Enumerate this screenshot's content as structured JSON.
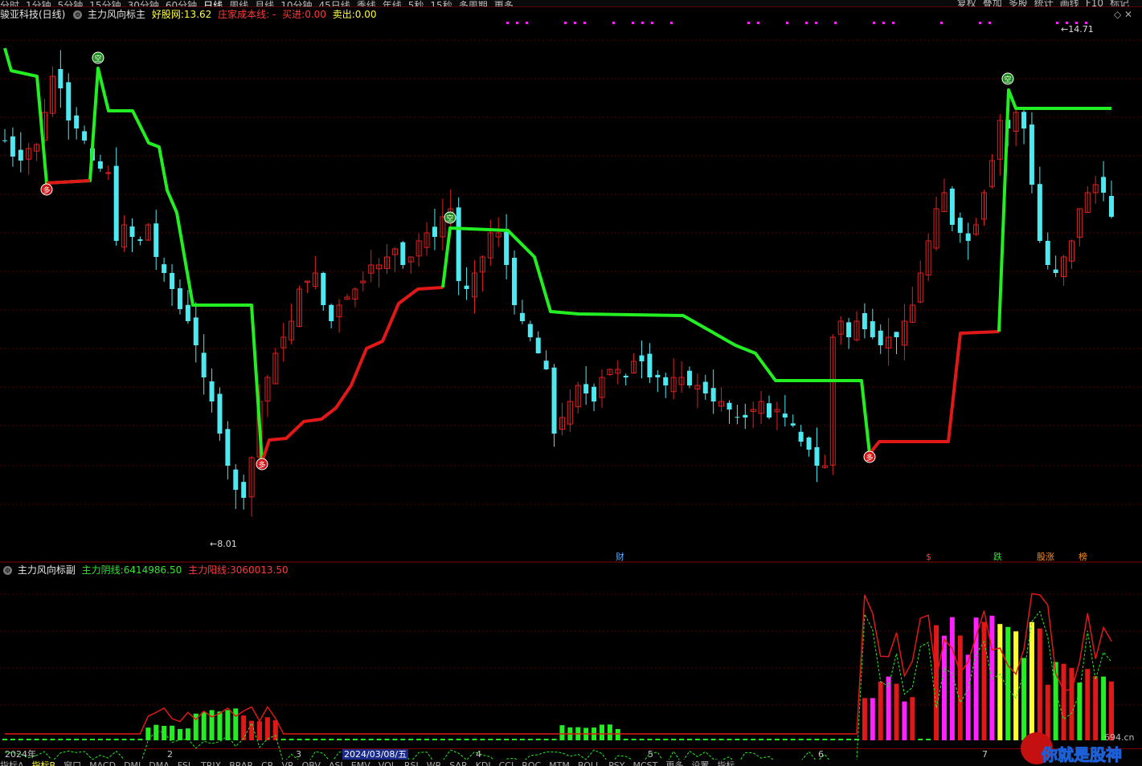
{
  "toolbar": {
    "periods": [
      "分时",
      "1分钟",
      "5分钟",
      "15分钟",
      "30分钟",
      "60分钟",
      "日线",
      "周线",
      "月线",
      "10分钟",
      "45日线",
      "季线",
      "年线",
      "5秒",
      "15秒",
      "多周期",
      "更多"
    ],
    "right_items": [
      "复权",
      "叠加",
      "多股",
      "统计",
      "画线",
      "F10",
      "标记"
    ],
    "active_period": "日线"
  },
  "main": {
    "stock_title": "骏亚科技(日线)",
    "indicator_name": "主力风向标主",
    "labels": {
      "a": "好股网:",
      "b": "庄家成本线: -",
      "c": "买进:",
      "d": "卖出:"
    },
    "values": {
      "a": "13.62",
      "c": "0.00",
      "d": "0.00"
    },
    "high_label": "14.71",
    "low_label": "8.01",
    "markers": {
      "sell": "空",
      "buy": "多"
    },
    "events": [
      {
        "label": "财",
        "color": "#5aaaff"
      },
      {
        "label": "$",
        "color": "#ff3b3b"
      },
      {
        "label": "跌",
        "color": "#31e431"
      },
      {
        "label": "股涨",
        "color": "#ff8c1a"
      },
      {
        "label": "榜",
        "color": "#ff8c1a"
      }
    ]
  },
  "sub": {
    "indicator_name": "主力风向标副",
    "labels": {
      "yin": "主力阴线:",
      "yang": "主力阳线:"
    },
    "values": {
      "yin": "6414986.50",
      "yang": "3060013.50"
    }
  },
  "date_axis": [
    "2024年",
    "2",
    "3",
    "2024/03/08/五",
    "4",
    "5",
    "6",
    "7"
  ],
  "bottom_tabs": [
    "指标A",
    "指标B",
    "窗口",
    "MACD",
    "DMI",
    "DMA",
    "FSL",
    "TRIX",
    "BRAR",
    "CR",
    "VR",
    "OBV",
    "ASI",
    "EMV",
    "VOL",
    "RSI",
    "WR",
    "SAR",
    "KDJ",
    "CCI",
    "ROC",
    "MTM",
    "BOLL",
    "PSY",
    "MCST",
    "更多",
    "设置",
    "指标"
  ],
  "watermark": {
    "text": "你就是股神",
    "url": "694.cn"
  },
  "colors": {
    "bull": "#e02020",
    "bear": "#4ee8f0",
    "up_line": "#e01818",
    "down_line": "#22ee22",
    "magenta": "#ff22ff",
    "yellow": "#ffff30"
  },
  "chart_data": {
    "type": "candlestick",
    "x": [
      0,
      1,
      2,
      3,
      4,
      5,
      6,
      7,
      8,
      9,
      10,
      11,
      12,
      13,
      14,
      15,
      16,
      17,
      18,
      19,
      20,
      21,
      22,
      23,
      24,
      25,
      26,
      27,
      28,
      29,
      30,
      31,
      32,
      33,
      34,
      35,
      36,
      37,
      38,
      39,
      40,
      41,
      42,
      43,
      44,
      45,
      46,
      47,
      48,
      49,
      50,
      51,
      52,
      53,
      54,
      55,
      56,
      57,
      58,
      59,
      60,
      61,
      62,
      63,
      64,
      65,
      66,
      67,
      68,
      69,
      70,
      71,
      72,
      73,
      74,
      75,
      76,
      77,
      78,
      79,
      80,
      81,
      82,
      83,
      84,
      85,
      86,
      87,
      88,
      89,
      90,
      91,
      92,
      93,
      94,
      95,
      96,
      97,
      98,
      99,
      100,
      101,
      102,
      103,
      104,
      105,
      106,
      107,
      108,
      109,
      110,
      111,
      112,
      113,
      114,
      115,
      116,
      117,
      118,
      119,
      120,
      121,
      122,
      123,
      124,
      125,
      126,
      127,
      128,
      129,
      130,
      131,
      132,
      133,
      134,
      135,
      136,
      137,
      138,
      139,
      140,
      141,
      142,
      143,
      144,
      145,
      146,
      147,
      148,
      149,
      150,
      151,
      152,
      153,
      154,
      155,
      156,
      157,
      158,
      159,
      160,
      161,
      162,
      163,
      164,
      165,
      166,
      167,
      168,
      169,
      170,
      171,
      172,
      173,
      174,
      175,
      176,
      177,
      178,
      179,
      180,
      181,
      182,
      183,
      184,
      185,
      186,
      187,
      188,
      189,
      190,
      191,
      192,
      193,
      194,
      195,
      196,
      197,
      198,
      199,
      200,
      201,
      202,
      203,
      204,
      205,
      206,
      207,
      208,
      209,
      210,
      211,
      212,
      213,
      214,
      215,
      216,
      217,
      218,
      219,
      220,
      221,
      222,
      223,
      224,
      225,
      226,
      227,
      228,
      229,
      230,
      231,
      232,
      233,
      234,
      235,
      236,
      237,
      238,
      239,
      240,
      241,
      242,
      243,
      244,
      245,
      246,
      247,
      248,
      249,
      250,
      251,
      252,
      253,
      254,
      255,
      256,
      257,
      258,
      259,
      260,
      261,
      262,
      263,
      264,
      265,
      266,
      267,
      268,
      269,
      270,
      271,
      272,
      273,
      274,
      275,
      276,
      277,
      278,
      279,
      280,
      281,
      282,
      283,
      284,
      285,
      286,
      287,
      288,
      289,
      290,
      291,
      292,
      293,
      294,
      295,
      296,
      297,
      298,
      299,
      300,
      301,
      302,
      303,
      304,
      305,
      306,
      307,
      308,
      309,
      310,
      311,
      312,
      313,
      314,
      315,
      316,
      317,
      318,
      319,
      320,
      321,
      322,
      323,
      324,
      325,
      326,
      327,
      328,
      329,
      330,
      331,
      332,
      333,
      334,
      335,
      336,
      337,
      338,
      339,
      340,
      341,
      342,
      343,
      344,
      345,
      346,
      347,
      348,
      349,
      350,
      351,
      352,
      353,
      354,
      355,
      356,
      357,
      358,
      359,
      360,
      361,
      362,
      363,
      364,
      365,
      366,
      367,
      368,
      369,
      370,
      371,
      372,
      373,
      374,
      375,
      376,
      377,
      378,
      379,
      380,
      381,
      382,
      383,
      384,
      385,
      386,
      387,
      388,
      389,
      390,
      391,
      392,
      393,
      394,
      395,
      396,
      397,
      398,
      399,
      400,
      401,
      402,
      403,
      404,
      405,
      406,
      407,
      408,
      409,
      410,
      411,
      412,
      413,
      414,
      415,
      416,
      417,
      418,
      419,
      420,
      421,
      422,
      423,
      424,
      425,
      426,
      427,
      428,
      429,
      430,
      431,
      432,
      433,
      434,
      435,
      436,
      437,
      438,
      439,
      440,
      441,
      442,
      443,
      444,
      445,
      446,
      447,
      448,
      449,
      450,
      451,
      452,
      453,
      454,
      455,
      456,
      457,
      458,
      459,
      460,
      461,
      462,
      463,
      464,
      465,
      466,
      467,
      468,
      469,
      470,
      471,
      472,
      473,
      474,
      475,
      476,
      477,
      478,
      479,
      480,
      481,
      482,
      483,
      484,
      485,
      486,
      487,
      488,
      489,
      490,
      491,
      492,
      493,
      494,
      495,
      496,
      497,
      498,
      499,
      500,
      501,
      502,
      503,
      504,
      505,
      506,
      507,
      508,
      509,
      510,
      511,
      512,
      513,
      514,
      515,
      516,
      517,
      518,
      519,
      520,
      521,
      522,
      523,
      524,
      525,
      526,
      527,
      528,
      529,
      530,
      531,
      532,
      533,
      534,
      535,
      536,
      537,
      538,
      539,
      540,
      541,
      542,
      543,
      544,
      545,
      546,
      547,
      548,
      549,
      550,
      551,
      552,
      553,
      554,
      555,
      556,
      557,
      558,
      559,
      560,
      561,
      562,
      563,
      564,
      565,
      566,
      567,
      568,
      569,
      570,
      571,
      572,
      573,
      574,
      575,
      576,
      577,
      578,
      579,
      580,
      581,
      582,
      583,
      584,
      585,
      586,
      587,
      588,
      589,
      590,
      591,
      592,
      593,
      594,
      595,
      596,
      597,
      598,
      599,
      600,
      601,
      602,
      603,
      604,
      605,
      606,
      607,
      608,
      609,
      610,
      611,
      612,
      613,
      614,
      615,
      616,
      617,
      618,
      619,
      620,
      621,
      622,
      623,
      624,
      625,
      626,
      627,
      628,
      629,
      630,
      631,
      632,
      633,
      634,
      635,
      636,
      637,
      638,
      639,
      640,
      641,
      642,
      643,
      644,
      645,
      646,
      647,
      648,
      649,
      650,
      651,
      652,
      653,
      654,
      655,
      656,
      657,
      658,
      659,
      660,
      661,
      662,
      663,
      664,
      665,
      666,
      667,
      668,
      669,
      670,
      671,
      672,
      673,
      674,
      675,
      676,
      677,
      678,
      679,
      680,
      681,
      682,
      683,
      684,
      685,
      686,
      687,
      688,
      689,
      690,
      691,
      692,
      693,
      694,
      695,
      696,
      697,
      698,
      699,
      700,
      701,
      702,
      703,
      704,
      705,
      706,
      707,
      708,
      709,
      710,
      711,
      712,
      713,
      714,
      715,
      716,
      717,
      718,
      719,
      720,
      721,
      722,
      723,
      724,
      725,
      726,
      727,
      728,
      729,
      730,
      731,
      732,
      733,
      734,
      735,
      736,
      737,
      738,
      739,
      740,
      741,
      742,
      743,
      744,
      745,
      746,
      747,
      748,
      749,
      750,
      751,
      752,
      753,
      754,
      755,
      756,
      757,
      758,
      759,
      760,
      761,
      762,
      763,
      764,
      765,
      766,
      767,
      768,
      769,
      770,
      771,
      772,
      773,
      774,
      775,
      776,
      777,
      778,
      779,
      780,
      781,
      782,
      783,
      784,
      785,
      786,
      787,
      788,
      789,
      790,
      791,
      792,
      793,
      794,
      795,
      796,
      797,
      798,
      799,
      800,
      801,
      802,
      803,
      804,
      805,
      806,
      807,
      808,
      809,
      810,
      811,
      812,
      813,
      814,
      815,
      816,
      817,
      818,
      819,
      820,
      821,
      822,
      823,
      824,
      825,
      826,
      827,
      828,
      829,
      830,
      831,
      832,
      833,
      834,
      835,
      836,
      837,
      838,
      839,
      840,
      841,
      842,
      843,
      844,
      845,
      846,
      847,
      848,
      849,
      850,
      851,
      852,
      853,
      854,
      855,
      856,
      857,
      858,
      859,
      860,
      861,
      862,
      863,
      864,
      865,
      866,
      867,
      868,
      869,
      870,
      871,
      872,
      873,
      874,
      875,
      876,
      877,
      878,
      879,
      880,
      881,
      882,
      883,
      884,
      885,
      886,
      887,
      888,
      889,
      890,
      891,
      892,
      893,
      894,
      895,
      896,
      897,
      898,
      899,
      900,
      901,
      902,
      903,
      904,
      905,
      906,
      907,
      908,
      909,
      910,
      911,
      912,
      913,
      914,
      915,
      916,
      917,
      918,
      919,
      920,
      921,
      922,
      923,
      924,
      925,
      926,
      927,
      928,
      929,
      930,
      931,
      932,
      933,
      934,
      935,
      936,
      937,
      938,
      939,
      940,
      941,
      942,
      943,
      944,
      945,
      946,
      947,
      948,
      949,
      950,
      951,
      952,
      953,
      954,
      955,
      956,
      957,
      958,
      959,
      960,
      961,
      962,
      963,
      964,
      965,
      966,
      967,
      968,
      969,
      970,
      971,
      972,
      973,
      974,
      975,
      976,
      977,
      978,
      979,
      980,
      981,
      982,
      983,
      984,
      985,
      986,
      987,
      988,
      989,
      990,
      991,
      992,
      993,
      994,
      995,
      996,
      997,
      998,
      999,
      1000,
      1001,
      1002,
      1003,
      1004,
      1005,
      1006,
      1007,
      1008,
      1009,
      1010,
      1011,
      1012,
      1013,
      1014,
      1015,
      1016,
      1017,
      1018,
      1019,
      1020,
      1021,
      1022,
      1023,
      1024,
      1025,
      1026,
      1027,
      1028,
      1029,
      1030,
      1031,
      1032,
      1033,
      1034,
      1035,
      1036,
      1037,
      1038,
      1039,
      1040,
      1041,
      1042,
      1043,
      1044,
      1045,
      1046,
      1047,
      1048,
      1049,
      1050,
      1051,
      1052,
      1053,
      1054,
      1055,
      1056,
      1057,
      1058,
      1059,
      1060,
      1061,
      1062,
      1063,
      1064,
      1065,
      1066,
      1067,
      1068,
      1069,
      1070,
      1071,
      1072,
      1073,
      1074,
      1075,
      1076,
      1077,
      1078,
      1079,
      1080,
      1081,
      1082,
      1083,
      1084,
      1085,
      1086,
      1087,
      1088,
      1089,
      1090,
      1091,
      1092,
      1093,
      1094,
      1095,
      1096,
      1097,
      1098,
      1099,
      1100,
      1101,
      1102,
      1103,
      1104,
      1105,
      1106,
      1107,
      1108,
      1109,
      1110,
      1111,
      1112,
      1113,
      1114,
      1115,
      1116,
      1117,
      1118,
      1119,
      1120,
      1121,
      1122,
      1123,
      1124,
      1125,
      1126,
      1127,
      1128,
      1129,
      1130,
      1131,
      1132,
      1133,
      1134,
      1135,
      1136,
      1137,
      1138,
      1139,
      1140,
      1141,
      1142,
      1143,
      1144,
      1145,
      1146,
      1147,
      1148,
      1149,
      1150,
      1151,
      1152,
      1153,
      1154,
      1155,
      1156,
      1157,
      1158,
      1159,
      1160,
      1161,
      1162,
      1163,
      1164,
      1165,
      1166,
      1167,
      1168,
      1169,
      1170,
      1171,
      1172,
      1173,
      1174,
      1175,
      1176,
      1177,
      1178,
      1179,
      1180,
      1181,
      1182,
      1183,
      1184,
      1185,
      1186,
      1187,
      1188,
      1189,
      1190,
      1191,
      1192,
      1193,
      1194,
      1195,
      1196,
      1197,
      1198,
      1199,
      1200,
      1201,
      1202,
      1203,
      1204,
      1205,
      1206,
      1207,
      1208,
      1209,
      1210,
      1211,
      1212,
      1213,
      1214,
      1215,
      1216,
      1217,
      1218,
      1219,
      1220,
      1221,
      1222,
      1223,
      1224,
      1225,
      1226,
      1227,
      1228,
      1229,
      1230,
      1231,
      1232,
      1233,
      1234,
      1235,
      1236,
      1237,
      1238,
      1239,
      1240,
      1241,
      1242,
      1243,
      1244,
      1245,
      1246,
      1247,
      1248,
      1249,
      1250,
      1251,
      1252,
      1253,
      1254,
      1255,
      1256,
      1257,
      1258,
      1259,
      1260,
      1261,
      1262,
      1263,
      1264,
      1265,
      1266,
      1267,
      1268,
      1269,
      1270,
      1271,
      1272,
      1273,
      1274,
      1275,
      1276,
      1277,
      1278,
      1279,
      1280,
      1281,
      1282,
      1283,
      1284,
      1285,
      1286,
      1287,
      1288,
      1289,
      1290,
      1291,
      1292,
      1293,
      1294,
      1295,
      1296,
      1297,
      1298,
      1299,
      1300,
      1301,
      1302,
      1303,
      1304,
      1305,
      1306,
      1307,
      1308,
      1309,
      1310,
      1311,
      1312,
      1313,
      1314,
      1315,
      1316,
      1317,
      1318,
      1319,
      1320,
      1321,
      1322,
      1323,
      1324,
      1325,
      1326,
      1327,
      1328,
      1329,
      1330,
      1331,
      1332,
      1333,
      1334,
      1335,
      1336,
      1337,
      1338,
      1339,
      1340,
      1341,
      1342,
      1343,
      1344,
      1345,
      1346,
      1347,
      1348,
      1349,
      1350,
      1351,
      1352,
      1353,
      1354,
      1355,
      1356,
      1357,
      1358,
      1359,
      1360,
      1361,
      1362,
      1363,
      1364,
      1365,
      1366,
      1367,
      1368,
      1369,
      1370,
      1371,
      1372,
      1373,
      1374,
      1375,
      1376,
      1377,
      1378,
      1379,
      1380,
      1381,
      1382,
      1383,
      1384,
      1385,
      1386,
      1387,
      1388,
      1389,
      1390,
      1391,
      1392,
      1393,
      1394,
      1395,
      1396,
      1397,
      1398,
      1399,
      1400,
      1401,
      1402,
      1403,
      1404,
      1405,
      1406,
      1407,
      1408,
      1409,
      1410,
      1411,
      1412,
      1413,
      1414,
      1415,
      1416,
      1417,
      1418,
      1419,
      1420
    ],
    "note": ""
  }
}
